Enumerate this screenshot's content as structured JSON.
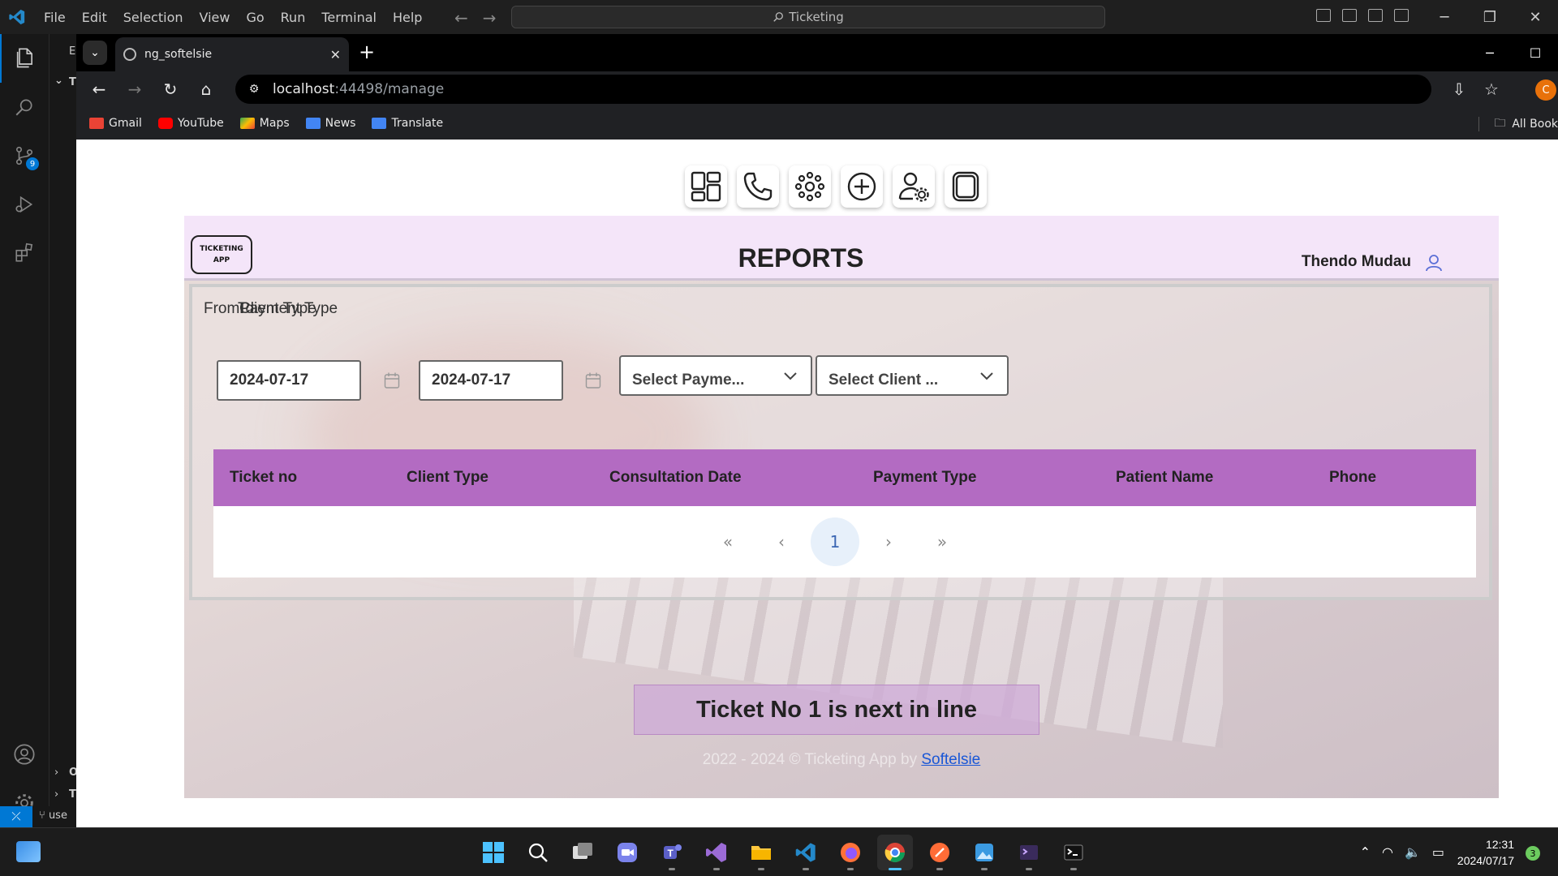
{
  "vscode": {
    "menu": [
      "File",
      "Edit",
      "Selection",
      "View",
      "Go",
      "Run",
      "Terminal",
      "Help"
    ],
    "search_text": "Ticketing",
    "source_control_badge": "9",
    "explorer_letters": [
      "E",
      "T",
      "O",
      "T"
    ],
    "status_branch": "use"
  },
  "browser": {
    "tab_title": "ng_softelsie",
    "url_host": "localhost",
    "url_path": ":44498/manage",
    "profile_initial": "C",
    "bookmarks": [
      {
        "label": "Gmail",
        "color": "#ea4335"
      },
      {
        "label": "YouTube",
        "color": "#ff0000"
      },
      {
        "label": "Maps",
        "color": "#34a853"
      },
      {
        "label": "News",
        "color": "#4285f4"
      },
      {
        "label": "Translate",
        "color": "#4285f4"
      }
    ],
    "all_bookmarks": "All Book"
  },
  "app": {
    "logo_line1": "TICKETING",
    "logo_line2": "APP",
    "title": "REPORTS",
    "user_name": "Thendo Mudau",
    "filters": {
      "labels": [
        "From",
        "To",
        "Client Type",
        "Payment Type"
      ],
      "from_date": "2024-07-17",
      "to_date": "2024-07-17",
      "payment_select": "Select Payme...",
      "client_select": "Select Client ..."
    },
    "table": {
      "headers": [
        "Ticket no",
        "Client Type",
        "Consultation Date",
        "Payment Type",
        "Patient Name",
        "Phone"
      ],
      "header_color": "#b36bc2"
    },
    "pager": {
      "first": "«",
      "prev": "‹",
      "current": "1",
      "next": "›",
      "last": "»"
    },
    "next_banner": "Ticket No 1 is next in line",
    "footer_text": "2022 - 2024 © Ticketing App by",
    "footer_link": "Softelsie"
  },
  "taskbar": {
    "time": "12:31",
    "date": "2024/07/17",
    "notifications": "3"
  }
}
